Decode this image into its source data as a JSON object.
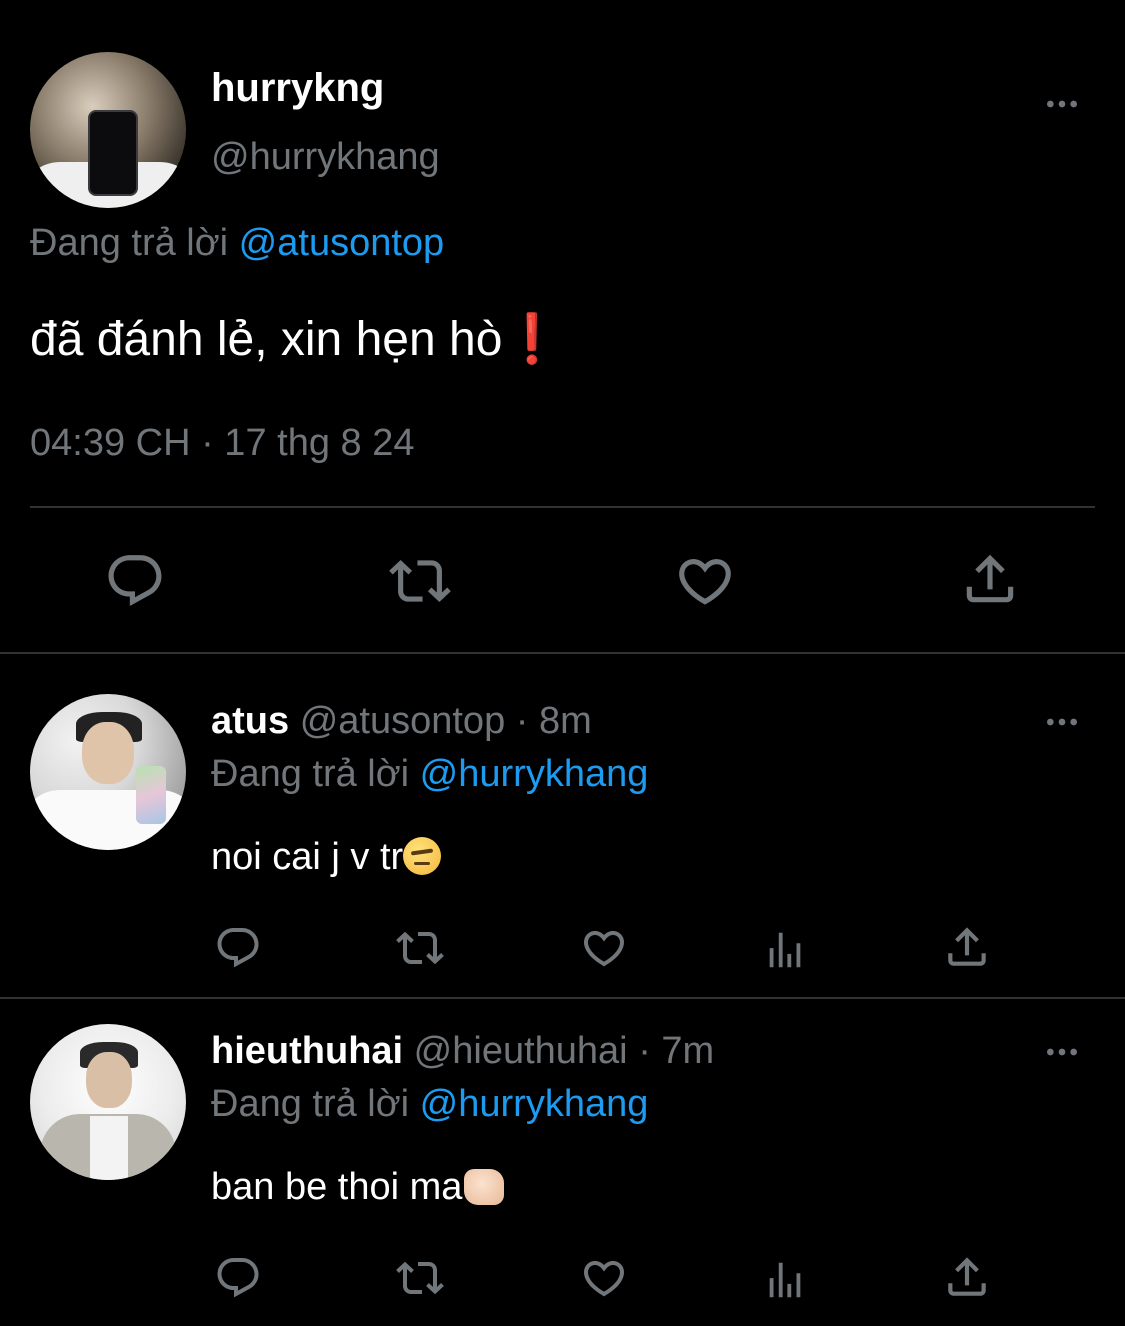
{
  "main_tweet": {
    "display_name": "hurrykng",
    "handle": "@hurrykhang",
    "replying_prefix": "Đang trả lời",
    "replying_to": "@atusontop",
    "text": "đã đánh lẻ, xin hẹn hò",
    "text_emoji": "❗",
    "timestamp": "04:39 CH · 17 thg 8 24",
    "actions": [
      "reply-icon",
      "retweet-icon",
      "like-icon",
      "share-icon"
    ]
  },
  "replies": [
    {
      "display_name": "atus",
      "handle": "@atusontop",
      "time": "· 8m",
      "replying_prefix": "Đang trả lời",
      "replying_to": "@hurrykhang",
      "text": "noi cai j v tr",
      "emoji": "face-with-raised-eyebrow",
      "actions": [
        "reply-icon",
        "retweet-icon",
        "like-icon",
        "views-icon",
        "share-icon"
      ]
    },
    {
      "display_name": "hieuthuhai",
      "handle": "@hieuthuhai",
      "time": "· 7m",
      "replying_prefix": "Đang trả lời",
      "replying_to": "@hurrykhang",
      "text": "ban be thoi ma",
      "emoji": "oncoming-fist",
      "actions": [
        "reply-icon",
        "retweet-icon",
        "like-icon",
        "views-icon",
        "share-icon"
      ]
    }
  ],
  "colors": {
    "background": "#000000",
    "text": "#e7e9ea",
    "muted": "#71767b",
    "link": "#1d9bf0",
    "divider": "#2f3336"
  }
}
